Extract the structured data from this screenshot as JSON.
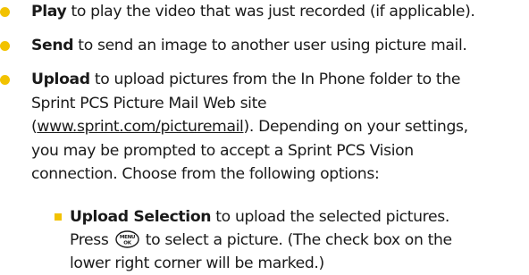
{
  "items": [
    {
      "term": "Play",
      "text": " to play the video that was just recorded (if applicable)."
    },
    {
      "term": "Send",
      "text": " to send an image to another user using picture mail."
    },
    {
      "term": "Upload",
      "line1": " to upload pictures from the In Phone folder to the",
      "line2": "Sprint PCS Picture Mail Web site",
      "link_open": "(",
      "link": "www.sprint.com/picturemail",
      "line3_rest": "). Depending on your settings,",
      "line4": "you may be prompted to accept a Sprint PCS Vision",
      "line5": "connection. Choose from the following options:"
    }
  ],
  "sub_item": {
    "term": "Upload Selection",
    "text1": " to upload the selected pictures.",
    "press": "Press ",
    "key_top": "MENU",
    "key_bottom": "OK",
    "text2": " to select a picture. (The check box on the",
    "text3": "lower right corner will be marked.)"
  },
  "colors": {
    "bullet": "#f2c200",
    "text": "#1a1a1a"
  }
}
